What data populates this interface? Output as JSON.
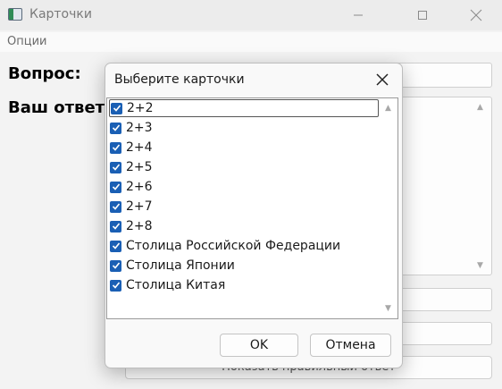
{
  "window": {
    "title": "Карточки",
    "menu": [
      "Опции"
    ]
  },
  "main": {
    "question_label": "Вопрос:",
    "answer_label": "Ваш ответ",
    "show_answer_button": "Показать правильный ответ"
  },
  "dialog": {
    "title": "Выберите карточки",
    "items": [
      {
        "label": "2+2",
        "checked": true
      },
      {
        "label": "2+3",
        "checked": true
      },
      {
        "label": "2+4",
        "checked": true
      },
      {
        "label": "2+5",
        "checked": true
      },
      {
        "label": "2+6",
        "checked": true
      },
      {
        "label": "2+7",
        "checked": true
      },
      {
        "label": "2+8",
        "checked": true
      },
      {
        "label": "Столица Российской Федерации",
        "checked": true
      },
      {
        "label": "Столица Японии",
        "checked": true
      },
      {
        "label": "Столица Китая",
        "checked": true
      }
    ],
    "ok_label": "OK",
    "cancel_label": "Отмена"
  },
  "colors": {
    "checkbox": "#1a5fb4",
    "window_bg": "#f3f3f3"
  }
}
